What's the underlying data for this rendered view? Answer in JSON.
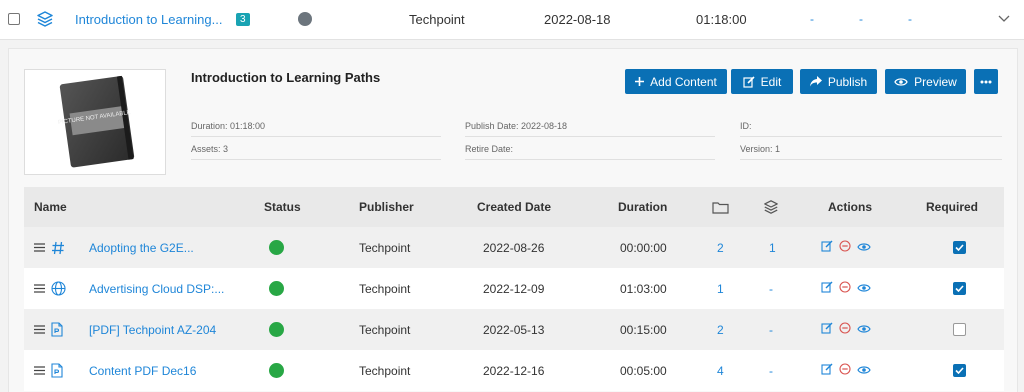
{
  "top_row": {
    "title": "Introduction to Learning...",
    "badge": "3",
    "publisher": "Techpoint",
    "date": "2022-08-18",
    "duration": "01:18:00",
    "dash1": "-",
    "dash2": "-",
    "dash3": "-"
  },
  "detail": {
    "title": "Introduction to Learning Paths",
    "thumbnail_text": "PICTURE NOT AVAILABLE",
    "duration": "Duration: 01:18:00",
    "assets": "Assets: 3",
    "publish_date": "Publish Date: 2022-08-18",
    "retire_date": "Retire Date:",
    "id": "ID:",
    "version": "Version: 1"
  },
  "buttons": {
    "add_content": "Add Content",
    "edit": "Edit",
    "publish": "Publish",
    "preview": "Preview"
  },
  "table": {
    "headers": {
      "name": "Name",
      "status": "Status",
      "publisher": "Publisher",
      "created": "Created Date",
      "duration": "Duration",
      "actions": "Actions",
      "required": "Required"
    },
    "rows": [
      {
        "icon": "hashtag-icon",
        "name": "Adopting the G2E...",
        "publisher": "Techpoint",
        "created": "2022-08-26",
        "duration": "00:00:00",
        "folders": "2",
        "layers": "1",
        "required": true
      },
      {
        "icon": "globe-icon",
        "name": "Advertising Cloud DSP:...",
        "publisher": "Techpoint",
        "created": "2022-12-09",
        "duration": "01:03:00",
        "folders": "1",
        "layers": "-",
        "required": true
      },
      {
        "icon": "pdf-file-icon",
        "name": "[PDF] Techpoint AZ-204",
        "publisher": "Techpoint",
        "created": "2022-05-13",
        "duration": "00:15:00",
        "folders": "2",
        "layers": "-",
        "required": false
      },
      {
        "icon": "pdf-file-icon",
        "name": "Content PDF Dec16",
        "publisher": "Techpoint",
        "created": "2022-12-16",
        "duration": "00:05:00",
        "folders": "4",
        "layers": "-",
        "required": true
      }
    ]
  },
  "colors": {
    "primary": "#0a70b5",
    "link": "#1f86d8",
    "status_green": "#28a745",
    "status_gray": "#6c757d",
    "badge": "#19a3b3"
  }
}
